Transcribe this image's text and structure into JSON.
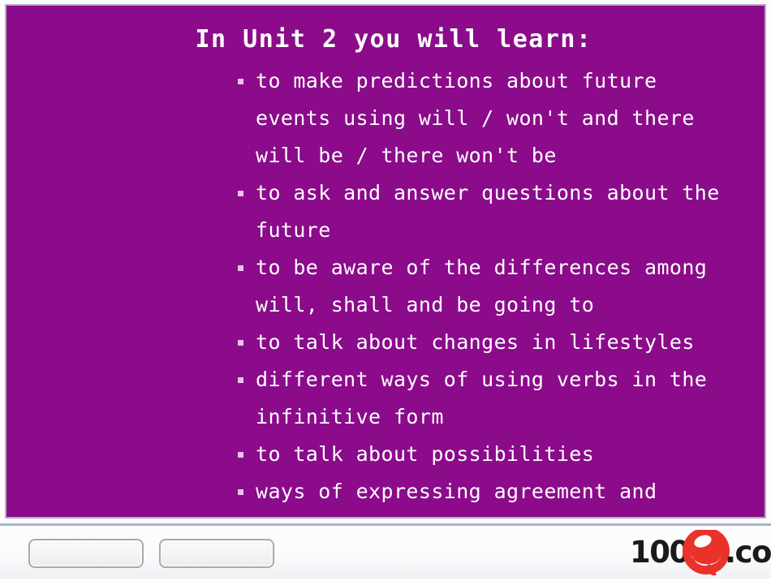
{
  "slide": {
    "background_color": "#8B0B8B",
    "title": "In Unit 2 you will learn:",
    "bullets": [
      {
        "text": "to make predictions about future events using will / won't and there will be / there won't be"
      },
      {
        "text": "to ask and answer questions about the future"
      },
      {
        "text": "to be aware of the differences among will, shall and be going to"
      },
      {
        "text": "to talk about changes in lifestyles"
      },
      {
        "text": "different ways of using verbs in the infinitive form"
      },
      {
        "text": "to talk about possibilities"
      },
      {
        "text": "ways of expressing agreement and"
      }
    ]
  },
  "footer": {
    "buttons": [
      {
        "label": ""
      },
      {
        "label": ""
      }
    ],
    "logo": {
      "prefix": "100",
      "e_letter": "e",
      "suffix": ".com",
      "accent_color": "#e8322a",
      "text_color": "#1a1a1a"
    }
  }
}
